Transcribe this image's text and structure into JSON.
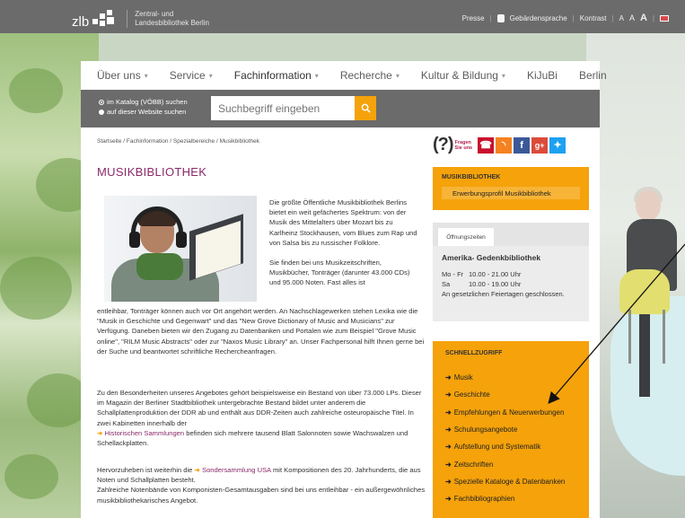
{
  "topbar": {
    "logo_short": "zlb",
    "logo_line1": "Zentral- und",
    "logo_line2": "Landesbibliothek Berlin",
    "links": {
      "presse": "Presse",
      "gebaerden": "Gebärdensprache",
      "kontrast": "Kontrast",
      "font_small": "A",
      "font_mid": "A",
      "font_big": "A"
    }
  },
  "nav": {
    "items": [
      {
        "label": "Über uns",
        "chev": "▾"
      },
      {
        "label": "Service",
        "chev": "▾"
      },
      {
        "label": "Fachinformation",
        "chev": "▾"
      },
      {
        "label": "Recherche",
        "chev": "▾"
      },
      {
        "label": "Kultur & Bildung",
        "chev": "▾"
      },
      {
        "label": "KiJuBi",
        "chev": ""
      },
      {
        "label": "Berlin",
        "chev": ""
      }
    ]
  },
  "search": {
    "option1": "im Katalog (VÖBB) suchen",
    "option2": "auf dieser Website suchen",
    "placeholder": "Suchbegriff eingeben"
  },
  "breadcrumb": "Startseite / Fachinformation / Spezialbereiche / Musikbibliothek",
  "social": {
    "qmark": "(?)",
    "fragen1": "Fragen",
    "fragen2": "Sie uns",
    "facebook": "f",
    "googleplus": "g+"
  },
  "title": "MUSIKBIBLIOTHEK",
  "intro": "Die größte Öffentliche Musikbibliothek Berlins bietet ein weit gefächertes Spektrum: von der Musik des Mittelalters über Mozart bis zu Karlheinz Stockhausen, vom Blues zum Rap und von Salsa bis zu russischer Folklore.",
  "intro2": "Sie finden bei uns Musikzeitschriften, Musikbücher, Tonträger (darunter 43.000 CDs) und 95.000 Noten. Fast alles ist",
  "para1": "entleihbar, Tonträger können auch vor Ort angehört werden. An Nachschlagewerken stehen Lexika wie die \"Musik in Geschichte und Gegenwart\" und das \"New Grove Dictionary of Music and Musicians\" zur Verfügung. Daneben bieten wir den Zugang zu Datenbanken und Portalen wie zum Beispiel \"Grove Music online\", \"RILM Music Abstracts\" oder zur \"Naxos Music Library\" an. Unser Fachpersonal hilft Ihnen gerne bei der Suche und beantwortet schriftliche Rechercheanfragen.",
  "para2": "Zu den Besonderheiten unseres Angebotes gehört beispielsweise ein Bestand von über 73.000 LPs. Dieser im Magazin der Berliner Stadtbibliothek untergebrachte Bestand bildet unter anderem die Schallplattenproduktion der DDR ab und enthält aus DDR-Zeiten auch zahlreiche osteuropäische Titel. In zwei Kabinetten innerhalb der",
  "para2_link": "Historischen Sammlungen",
  "para2_end": "befinden sich mehrere tausend Blatt Salonnoten sowie Wachswalzen und Schellackplatten.",
  "para3_a": "Hervorzuheben ist weiterhin die",
  "para3_link": "Sondersammlung USA",
  "para3_b": "mit Kompositionen des 20. Jahrhunderts, die aus Noten und Schallplatten besteht.",
  "para4": "Zahlreiche Notenbände von Komponisten-Gesamtausgaben sind bei uns entleihbar - ein außergewöhnliches musikbibliothekarisches Angebot.",
  "sidebar": {
    "box1_title": "MUSIKBIBLIOTHEK",
    "box1_button": "Erwerbungsprofil Musikbibliothek",
    "hours_tab": "Öffnungszeiten",
    "library": "Amerika- Gedenkbibliothek",
    "hours": [
      {
        "days": "Mo - Fr",
        "time": "10.00 - 21.00 Uhr"
      },
      {
        "days": "Sa",
        "time": "10.00 - 19.00 Uhr"
      }
    ],
    "hours_note": "An gesetzlichen Feiertagen geschlossen.",
    "quick_title": "SCHNELLZUGRIFF",
    "quick": [
      "Musik",
      "Geschichte",
      "Empfehlungen & Neuerwerbungen",
      "Schulungsangebote",
      "Aufstellung und Systematik",
      "Zeitschriften",
      "Spezielle Kataloge & Datenbanken",
      "Fachbibliographien"
    ]
  },
  "colors": {
    "accent": "#f5a20b",
    "title": "#8a2a6b",
    "bar": "#6b6b6b"
  }
}
